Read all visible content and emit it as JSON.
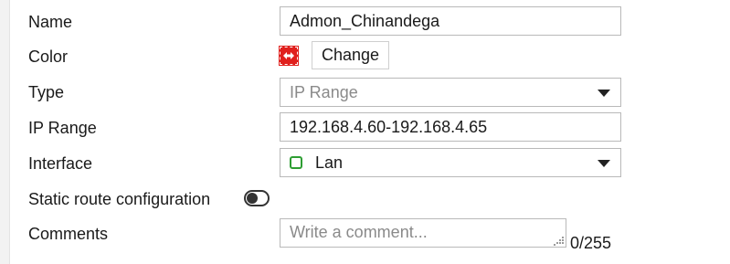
{
  "form": {
    "name": {
      "label": "Name",
      "value": "Admon_Chinandega"
    },
    "color": {
      "label": "Color",
      "swatch_color": "#e0201d",
      "swatch_icon": "double-arrow-icon",
      "change_label": "Change"
    },
    "type": {
      "label": "Type",
      "value": "IP Range",
      "disabled": true
    },
    "ip_range": {
      "label": "IP Range",
      "value": "192.168.4.60-192.168.4.65"
    },
    "interface": {
      "label": "Interface",
      "value": "Lan",
      "icon": "port-icon",
      "icon_color": "#2e9e33"
    },
    "static_route": {
      "label": "Static route configuration",
      "enabled": false
    },
    "comments": {
      "label": "Comments",
      "placeholder": "Write a comment...",
      "value": "",
      "counter": "0/255"
    }
  }
}
